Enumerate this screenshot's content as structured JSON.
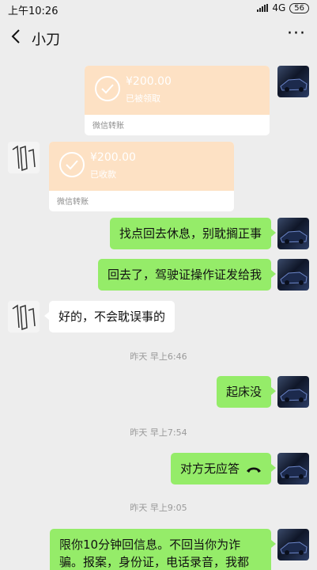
{
  "status": {
    "time": "上午10:26",
    "network": "4G",
    "battery": "56"
  },
  "header": {
    "title": "小刀"
  },
  "messages": {
    "transfer1": {
      "amount": "¥200.00",
      "status": "已被领取",
      "footer": "微信转账"
    },
    "transfer2": {
      "amount": "¥200.00",
      "status": "已收款",
      "footer": "微信转账"
    },
    "m1": "找点回去休息，别耽搁正事",
    "m2": "回去了，驾驶证操作证发给我",
    "m3": "好的，不会耽误事的",
    "ts1": "昨天 早上6:46",
    "m4": "起床没",
    "ts2": "昨天 早上7:54",
    "m5": "对方无应答",
    "ts3": "昨天 早上9:05",
    "m6_line1": "限你10分钟回信息。不回当你为诈",
    "m6_line2": "骗。报案，身份证，电话录音，我都"
  }
}
